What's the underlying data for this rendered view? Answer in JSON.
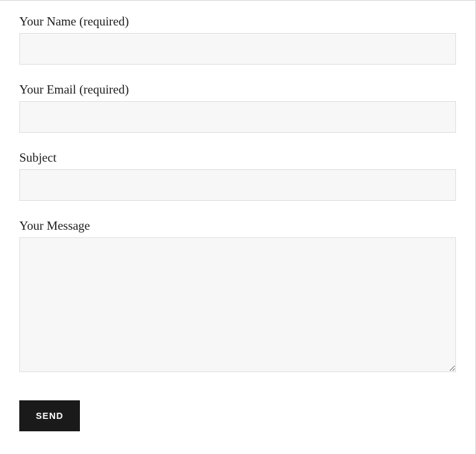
{
  "form": {
    "name_label": "Your Name (required)",
    "email_label": "Your Email (required)",
    "subject_label": "Subject",
    "message_label": "Your Message",
    "submit_label": "Send"
  }
}
